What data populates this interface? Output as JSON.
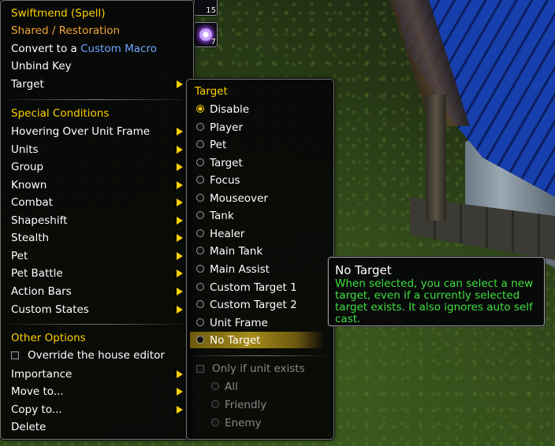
{
  "action_bar": {
    "button1": {
      "count": "15"
    },
    "button2": {
      "count": "7"
    }
  },
  "main_menu": {
    "header": "Swiftmend (Spell)",
    "subheader": "Shared / Restoration",
    "convert_prefix": "Convert to a ",
    "convert_link": "Custom Macro",
    "unbind": "Unbind Key",
    "target": "Target",
    "special_header": "Special Conditions",
    "special_items": [
      "Hovering Over Unit Frame",
      "Units",
      "Group",
      "Known",
      "Combat",
      "Shapeshift",
      "Stealth",
      "Pet",
      "Pet Battle",
      "Action Bars",
      "Custom States"
    ],
    "other_header": "Other Options",
    "override_label": "Override the house editor",
    "importance": "Importance",
    "move_to": "Move to...",
    "copy_to": "Copy to...",
    "delete": "Delete"
  },
  "target_menu": {
    "header": "Target",
    "options": [
      "Disable",
      "Player",
      "Pet",
      "Target",
      "Focus",
      "Mouseover",
      "Tank",
      "Healer",
      "Main Tank",
      "Main Assist",
      "Custom Target 1",
      "Custom Target 2",
      "Unit Frame",
      "No Target"
    ],
    "selected": "Disable",
    "hovered": "No Target",
    "only_if_exists": "Only if unit exists",
    "sub_options": [
      "All",
      "Friendly",
      "Enemy"
    ]
  },
  "tooltip": {
    "title": "No Target",
    "body": "When selected, you can select a new target, even if a currently selected target exists. It also ignores auto self cast."
  },
  "colors": {
    "gold": "#ffd100",
    "orange": "#f4a535",
    "link_blue": "#6ea6ff",
    "tooltip_green": "#3ee03e"
  }
}
